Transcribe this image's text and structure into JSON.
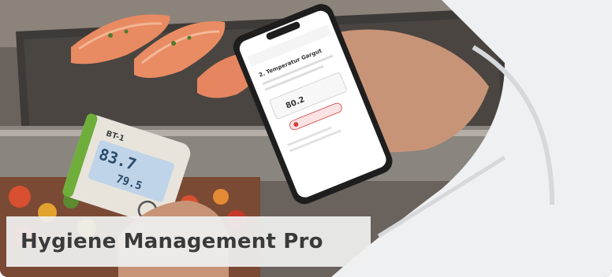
{
  "banner": {
    "title": "Hygiene Management Pro"
  },
  "phone": {
    "screen_heading": "2. Temperatur Gargut",
    "reading": "80.2"
  },
  "thermometer": {
    "label": "BT-1",
    "reading_top": "83.7",
    "reading_bottom": "79.5"
  },
  "colors": {
    "panel_bg": "#f0f0f0",
    "title_text": "#3a3a3a",
    "thermometer_body": "#e8e4dc",
    "thermometer_stripe": "#6fae3a",
    "alert_red": "#d23c3c"
  }
}
